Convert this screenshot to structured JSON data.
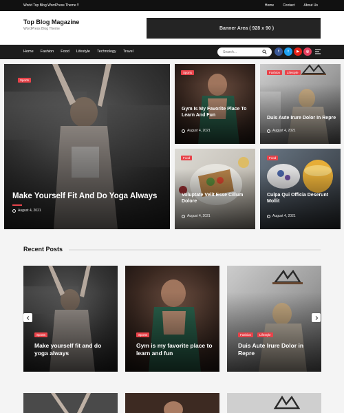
{
  "topbar": {
    "tagline": "World Top Blog WordPress Theme !!",
    "links": [
      "Home",
      "Contact",
      "About Us"
    ]
  },
  "header": {
    "site_title": "Top Blog Magazine",
    "site_description": "WordPress Blog Theme",
    "banner_text": "Banner Area ( 928 x 90 )"
  },
  "nav": {
    "items": [
      "Home",
      "Fashion",
      "Food",
      "Lifestyle",
      "Technology",
      "Travel"
    ],
    "search_placeholder": "Search...",
    "social": [
      "facebook-icon",
      "twitter-icon",
      "youtube-icon",
      "instagram-icon"
    ]
  },
  "featured": [
    {
      "badges": [
        "Sports"
      ],
      "title": "Make Yourself Fit And Do Yoga Always",
      "date": "August 4, 2021"
    },
    {
      "badges": [
        "Sports"
      ],
      "title": "Gym Is My Favorite Place To Learn And Fun",
      "date": "August 4, 2021"
    },
    {
      "badges": [
        "Fashion",
        "Lifestyle"
      ],
      "title": "Duis Aute Irure Dolor In Repre",
      "date": "August 4, 2021"
    },
    {
      "badges": [
        "Food"
      ],
      "title": "Voluptate Velit Esse Cillum Dolore",
      "date": "August 4, 2021"
    },
    {
      "badges": [
        "Food"
      ],
      "title": "Culpa Qui Officia Deserunt Mollit",
      "date": "August 4, 2021"
    }
  ],
  "recent": {
    "title": "Recent Posts",
    "posts": [
      {
        "badges": [
          "Sports"
        ],
        "title": "Make yourself fit and do yoga always"
      },
      {
        "badges": [
          "Sports"
        ],
        "title": "Gym is my favorite place to learn and fun"
      },
      {
        "badges": [
          "Fashion",
          "Lifestyle"
        ],
        "title": "Duis Aute Irure Dolor in Repre"
      }
    ]
  },
  "colors": {
    "accent": "#e8434a",
    "topbar": "#111111",
    "nav": "#1c1c1c"
  }
}
